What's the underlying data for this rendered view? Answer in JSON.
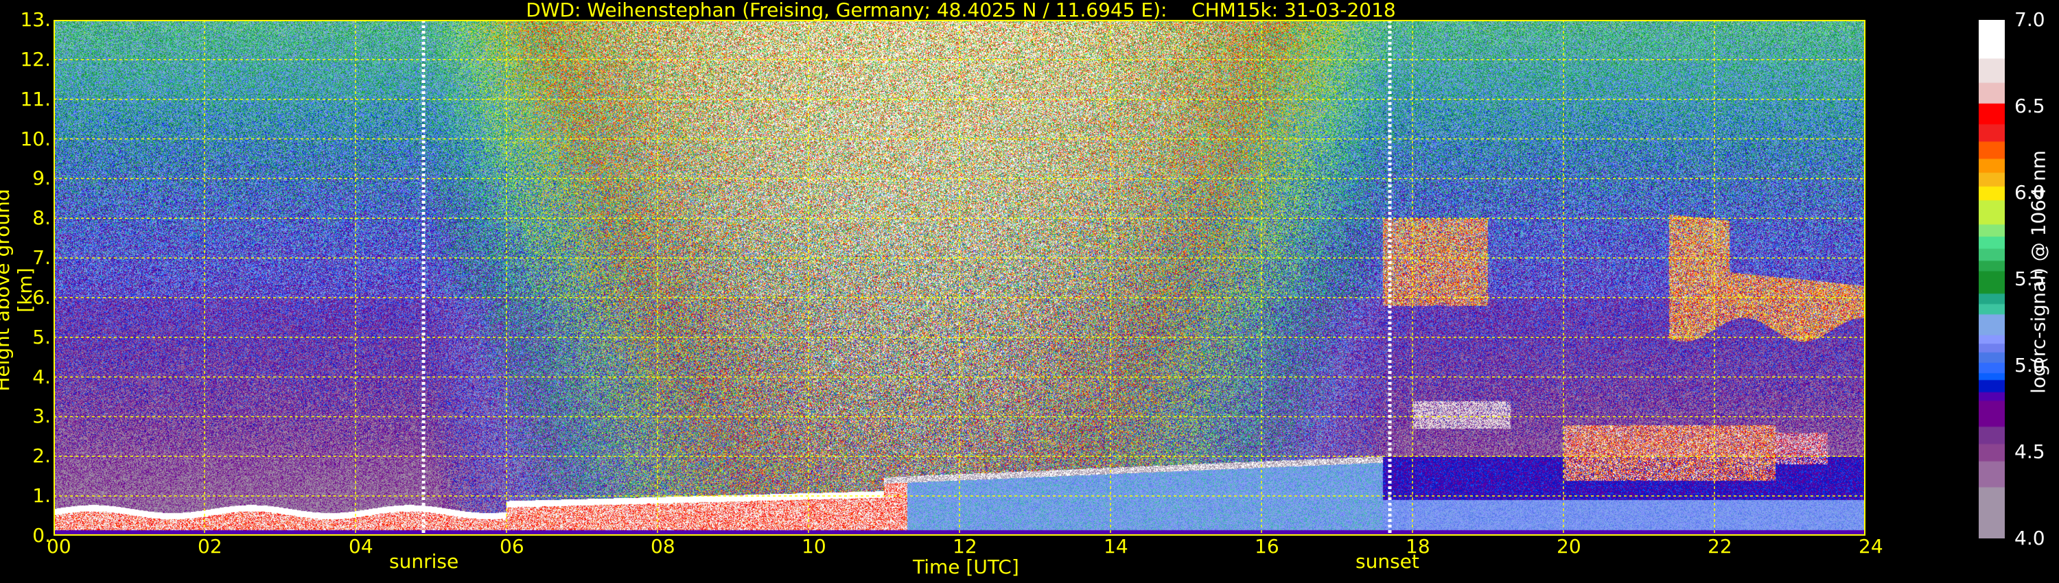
{
  "title": "DWD: Weihenstephan (Freising, Germany; 48.4025 N / 11.6945 E):    CHM15k: 31-03-2018",
  "chart_data": {
    "type": "heatmap",
    "title": "DWD: Weihenstephan (Freising, Germany; 48.4025 N / 11.6945 E):    CHM15k: 31-03-2018",
    "xlabel": "Time [UTC]",
    "ylabel": "Height above ground [km]",
    "xlim": [
      0,
      24
    ],
    "ylim": [
      0,
      13
    ],
    "xticks": [
      "00",
      "02",
      "04",
      "06",
      "08",
      "10",
      "12",
      "14",
      "16",
      "18",
      "20",
      "22",
      "24"
    ],
    "yticks": [
      "0.",
      "1.",
      "2.",
      "3.",
      "4.",
      "5.",
      "6.",
      "7.",
      "8.",
      "9.",
      "10.",
      "11.",
      "12.",
      "13."
    ],
    "grid": true,
    "annotations": [
      {
        "label": "sunrise",
        "time_h": 4.9
      },
      {
        "label": "sunset",
        "time_h": 17.7
      }
    ],
    "colorbar": {
      "label": "log(rc-signal) @ 1064 nm",
      "range": [
        4.0,
        7.0
      ],
      "ticks": [
        "4.0",
        "4.5",
        "5.0",
        "5.5",
        "6.0",
        "6.5",
        "7.0"
      ],
      "colors": [
        {
          "from": 4.0,
          "color": "#a293a8"
        },
        {
          "from": 4.3,
          "color": "#9a6ca0"
        },
        {
          "from": 4.45,
          "color": "#8b4490"
        },
        {
          "from": 4.55,
          "color": "#763590"
        },
        {
          "from": 4.65,
          "color": "#700090"
        },
        {
          "from": 4.8,
          "color": "#5200b0"
        },
        {
          "from": 4.85,
          "color": "#0018c8"
        },
        {
          "from": 4.92,
          "color": "#0a60ff"
        },
        {
          "from": 4.96,
          "color": "#2f6cff"
        },
        {
          "from": 5.02,
          "color": "#4a78e8"
        },
        {
          "from": 5.08,
          "color": "#7080f0"
        },
        {
          "from": 5.13,
          "color": "#8898ff"
        },
        {
          "from": 5.18,
          "color": "#80a8e8"
        },
        {
          "from": 5.3,
          "color": "#3cc4a0"
        },
        {
          "from": 5.36,
          "color": "#22a888"
        },
        {
          "from": 5.42,
          "color": "#18922c"
        },
        {
          "from": 5.55,
          "color": "#28a84c"
        },
        {
          "from": 5.61,
          "color": "#40c878"
        },
        {
          "from": 5.68,
          "color": "#4ce090"
        },
        {
          "from": 5.75,
          "color": "#88e878"
        },
        {
          "from": 5.82,
          "color": "#c4f040"
        },
        {
          "from": 5.96,
          "color": "#ffe808"
        },
        {
          "from": 6.04,
          "color": "#f8b818"
        },
        {
          "from": 6.12,
          "color": "#ff9800"
        },
        {
          "from": 6.2,
          "color": "#ff5c00"
        },
        {
          "from": 6.3,
          "color": "#f02020"
        },
        {
          "from": 6.4,
          "color": "#ff0000"
        },
        {
          "from": 6.52,
          "color": "#ecc0c0"
        },
        {
          "from": 6.64,
          "color": "#ede0e0"
        },
        {
          "from": 6.78,
          "color": "#ffffff"
        }
      ]
    },
    "features": [
      {
        "name": "boundary layer",
        "time_h": [
          0,
          24
        ],
        "height_km": [
          0,
          2.0
        ]
      },
      {
        "name": "cirrus cloud",
        "time_h": [
          17.6,
          19.0
        ],
        "height_km": [
          5.8,
          8.0
        ]
      },
      {
        "name": "cirrus cloud",
        "time_h": [
          21.4,
          24
        ],
        "height_km": [
          5.1,
          8.2
        ]
      },
      {
        "name": "aerosol/cloud layer",
        "time_h": [
          18.0,
          23.0
        ],
        "height_km": [
          1.5,
          3.5
        ]
      }
    ]
  }
}
